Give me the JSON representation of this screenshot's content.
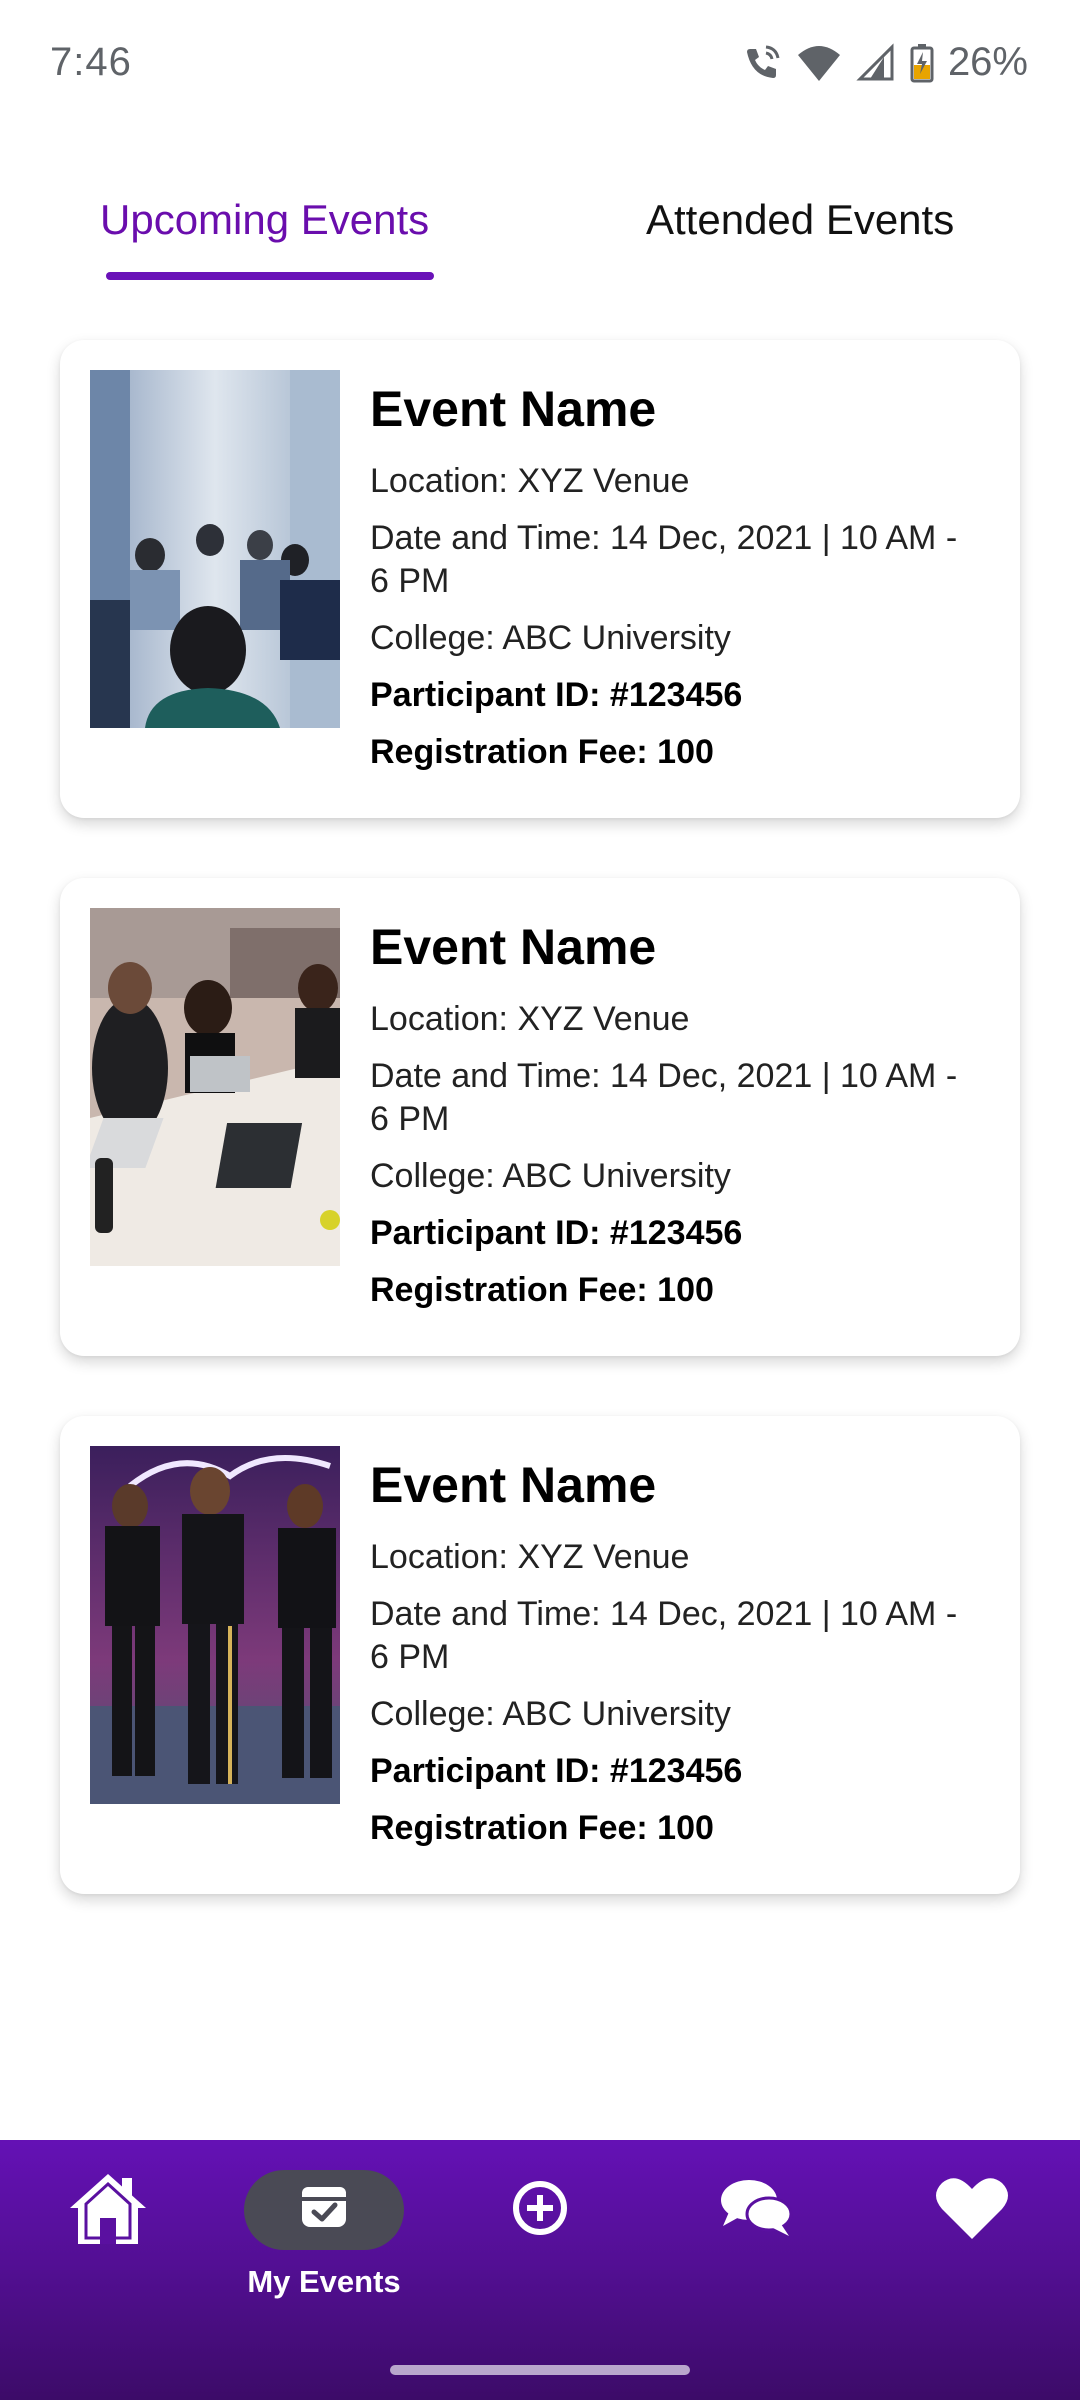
{
  "status_bar": {
    "time": "7:46",
    "battery": "26%",
    "icons": [
      "wifi-calling-icon",
      "wifi-icon",
      "cell-signal-icon",
      "battery-charging-icon"
    ]
  },
  "tabs": [
    {
      "label": "Upcoming Events",
      "active": true
    },
    {
      "label": "Attended Events",
      "active": false
    }
  ],
  "colors": {
    "accent": "#6a0dad",
    "nav_background": "#5a10a0",
    "active_pill": "#4a4a55"
  },
  "events": [
    {
      "name": "Event Name",
      "location": "Location: XYZ Venue",
      "datetime": "Date and Time: 14 Dec, 2021 | 10 AM - 6 PM",
      "college": "College: ABC University",
      "participant_id": "Participant ID: #123456",
      "fee": "Registration Fee: 100",
      "image": "seminar-audience-photo"
    },
    {
      "name": "Event Name",
      "location": "Location: XYZ Venue",
      "datetime": "Date and Time: 14 Dec, 2021 | 10 AM - 6 PM",
      "college": "College: ABC University",
      "participant_id": "Participant ID: #123456",
      "fee": "Registration Fee: 100",
      "image": "students-with-laptops-photo"
    },
    {
      "name": "Event Name",
      "location": "Location: XYZ Venue",
      "datetime": "Date and Time: 14 Dec, 2021 | 10 AM - 6 PM",
      "college": "College: ABC University",
      "participant_id": "Participant ID: #123456",
      "fee": "Registration Fee: 100",
      "image": "dance-performance-photo"
    }
  ],
  "bottom_nav": {
    "items": [
      {
        "icon": "home-icon",
        "label": ""
      },
      {
        "icon": "calendar-check-icon",
        "label": "My Events",
        "active": true
      },
      {
        "icon": "add-circle-icon",
        "label": ""
      },
      {
        "icon": "chat-bubbles-icon",
        "label": ""
      },
      {
        "icon": "heart-icon",
        "label": ""
      }
    ]
  }
}
